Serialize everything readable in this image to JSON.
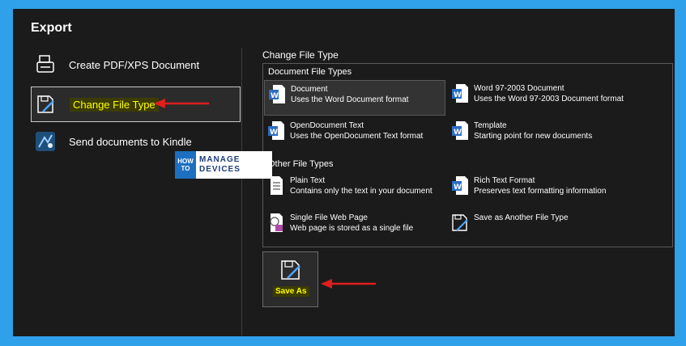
{
  "panel": {
    "title": "Export"
  },
  "nav": [
    {
      "label": "Create PDF/XPS Document",
      "icon": "pdf-icon"
    },
    {
      "label": "Change File Type",
      "icon": "change-file-type-icon",
      "selected": true
    },
    {
      "label": "Send documents to Kindle",
      "icon": "kindle-icon"
    }
  ],
  "change_file_type": {
    "title": "Change File Type",
    "document_group": "Document File Types",
    "other_group": "Other File Types",
    "document_types": [
      {
        "name": "Document",
        "desc": "Uses the Word Document format",
        "selected": true
      },
      {
        "name": "Word 97-2003 Document",
        "desc": "Uses the Word 97-2003 Document format"
      },
      {
        "name": "OpenDocument Text",
        "desc": "Uses the OpenDocument Text format"
      },
      {
        "name": "Template",
        "desc": "Starting point for new documents"
      }
    ],
    "other_types": [
      {
        "name": "Plain Text",
        "desc": "Contains only the text in your document"
      },
      {
        "name": "Rich Text Format",
        "desc": "Preserves text formatting information"
      },
      {
        "name": "Single File Web Page",
        "desc": "Web page is stored as a single file"
      },
      {
        "name": "Save as Another File Type",
        "desc": ""
      }
    ]
  },
  "save_as": {
    "label": "Save As"
  },
  "watermark": {
    "how": "HOW",
    "to": "TO",
    "line1": "MANAGE",
    "line2": "DEVICES"
  },
  "colors": {
    "accent_arrow": "#e01e1e",
    "highlight": "#ffff00",
    "word_blue": "#2b6cc4",
    "frame_border": "#2fa0ea"
  }
}
